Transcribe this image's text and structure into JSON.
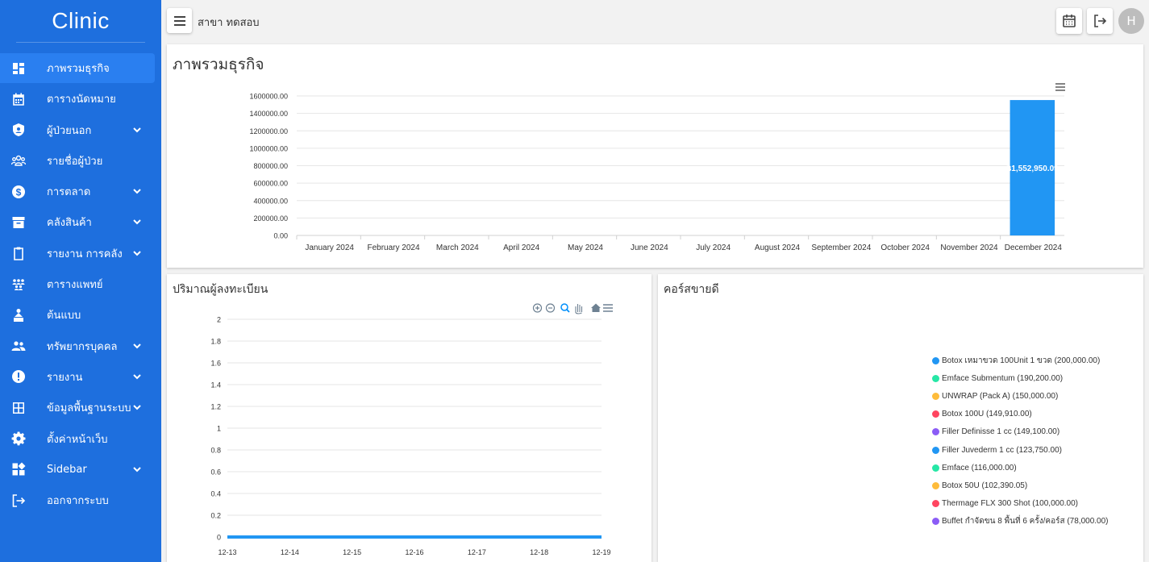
{
  "brand": "Clinic",
  "branch": "สาขา ทดสอบ",
  "user_initial": "H",
  "nav": [
    {
      "label": "ภาพรวมธุรกิจ",
      "icon": "dashboard-icon",
      "expand": false,
      "active": true
    },
    {
      "label": "ตารางนัดหมาย",
      "icon": "calendar-icon",
      "expand": false
    },
    {
      "label": "ผู้ป่วยนอก",
      "icon": "shield-icon",
      "expand": true
    },
    {
      "label": "รายชื่อผู้ป่วย",
      "icon": "people-group-icon",
      "expand": false
    },
    {
      "label": "การตลาด",
      "icon": "dollar-icon",
      "expand": true
    },
    {
      "label": "คลังสินค้า",
      "icon": "inventory-icon",
      "expand": true
    },
    {
      "label": "รายงาน การคลัง",
      "icon": "clipboard-icon",
      "expand": true
    },
    {
      "label": "ตารางแพทย์",
      "icon": "staff-schedule-icon",
      "expand": false
    },
    {
      "label": "ต้นแบบ",
      "icon": "shapes-icon",
      "expand": false
    },
    {
      "label": "ทรัพยากรบุคคล",
      "icon": "people-icon",
      "expand": true
    },
    {
      "label": "รายงาน",
      "icon": "alert-icon",
      "expand": true
    },
    {
      "label": "ข้อมูลพื้นฐานระบบ",
      "icon": "grid-icon",
      "expand": true
    },
    {
      "label": "ตั้งค่าหน้าเว็บ",
      "icon": "gear-icon",
      "expand": false
    },
    {
      "label": "Sidebar",
      "icon": "widgets-icon",
      "expand": true
    },
    {
      "label": "ออกจากระบบ",
      "icon": "logout-icon",
      "expand": false
    }
  ],
  "overview": {
    "title": "ภาพรวมธุรกิจ"
  },
  "registrations": {
    "title": "ปริมาณผู้ลงทะเบียน"
  },
  "bestsellers": {
    "title": "คอร์สขายดี"
  },
  "chart_data": [
    {
      "type": "bar",
      "categories": [
        "January 2024",
        "February 2024",
        "March 2024",
        "April 2024",
        "May 2024",
        "June 2024",
        "July 2024",
        "August 2024",
        "September 2024",
        "October 2024",
        "November 2024",
        "December 2024"
      ],
      "values": [
        0,
        0,
        0,
        0,
        0,
        0,
        0,
        0,
        0,
        0,
        0,
        1552950.09
      ],
      "data_labels": [
        "",
        "",
        "",
        "",
        "",
        "",
        "",
        "",
        "",
        "",
        "",
        "฿1,552,950.09"
      ],
      "yticks": [
        "0.00",
        "200000.00",
        "400000.00",
        "600000.00",
        "800000.00",
        "1000000.00",
        "1200000.00",
        "1400000.00",
        "1600000.00"
      ],
      "ylim": [
        0,
        1600000
      ],
      "color": "#2196f3",
      "grid": true
    },
    {
      "type": "line",
      "x": [
        "12-13",
        "12-14",
        "12-15",
        "12-16",
        "12-17",
        "12-18",
        "12-19"
      ],
      "values": [
        0,
        0,
        0,
        0,
        0,
        0,
        0
      ],
      "yticks": [
        "0",
        "0.2",
        "0.4",
        "0.6",
        "0.8",
        "1",
        "1.2",
        "1.4",
        "1.6",
        "1.8",
        "2"
      ],
      "ylim": [
        0,
        2
      ],
      "color": "#2196f3",
      "grid": true
    },
    {
      "type": "pie",
      "legend_position": "right",
      "series": [
        {
          "label": "Botox เหมาขวด 100Unit 1 ขวด (200,000.00)",
          "value": 200000.0,
          "color": "#2196f3"
        },
        {
          "label": "Emface Submentum (190,200.00)",
          "value": 190200.0,
          "color": "#26e7a6"
        },
        {
          "label": "UNWRAP (Pack A) (150,000.00)",
          "value": 150000.0,
          "color": "#febc3b"
        },
        {
          "label": "Botox 100U (149,910.00)",
          "value": 149910.0,
          "color": "#ff4560"
        },
        {
          "label": "Filler Definisse 1 cc (149,100.00)",
          "value": 149100.0,
          "color": "#8b5cf6"
        },
        {
          "label": "Filler Juvederm 1 cc (123,750.00)",
          "value": 123750.0,
          "color": "#2196f3"
        },
        {
          "label": "Emface (116,000.00)",
          "value": 116000.0,
          "color": "#26e7a6"
        },
        {
          "label": "Botox 50U (102,390.05)",
          "value": 102390.05,
          "color": "#febc3b"
        },
        {
          "label": "Thermage FLX 300 Shot (100,000.00)",
          "value": 100000.0,
          "color": "#ff4560"
        },
        {
          "label": "Buffet กำจัดขน 8 พื้นที่ 6 ครั้ง/คอร์ส (78,000.00)",
          "value": 78000.0,
          "color": "#8b5cf6"
        }
      ]
    }
  ]
}
